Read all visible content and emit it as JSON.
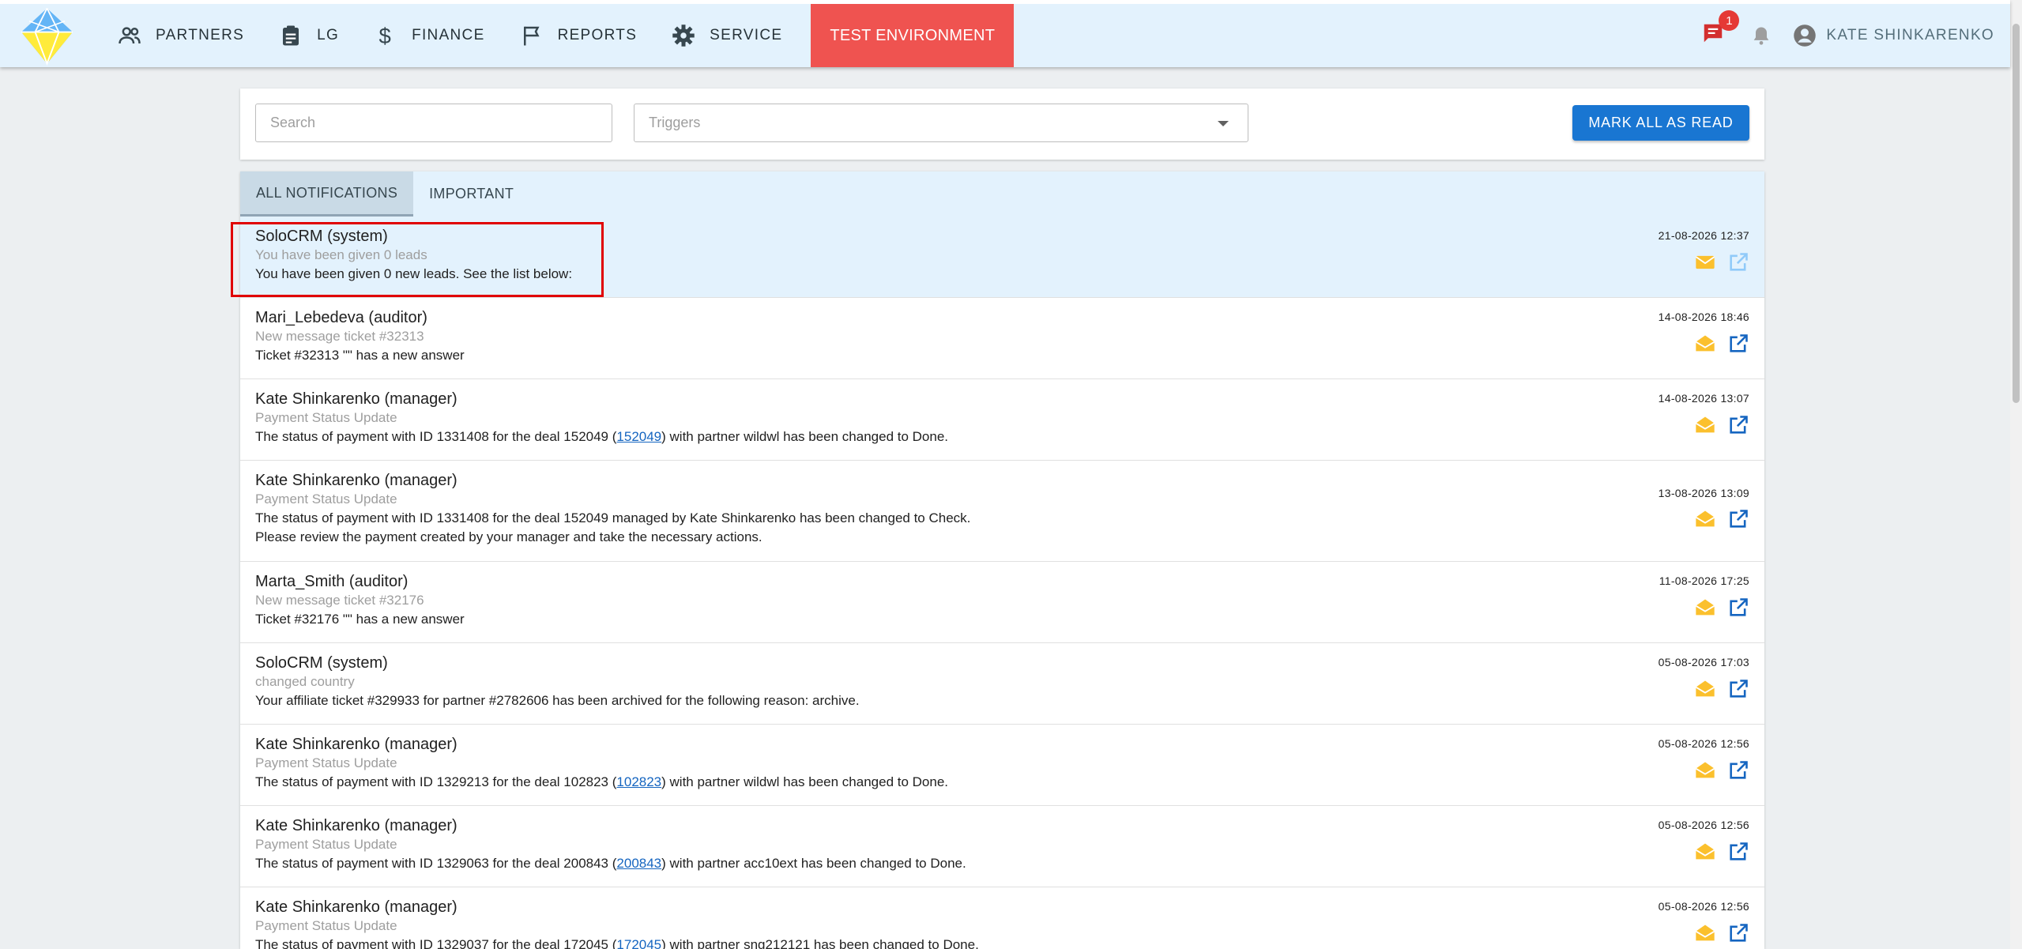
{
  "nav": {
    "items": [
      {
        "label": "PARTNERS",
        "icon": "people-icon"
      },
      {
        "label": "LG",
        "icon": "clipboard-icon"
      },
      {
        "label": "FINANCE",
        "icon": "dollar-icon"
      },
      {
        "label": "REPORTS",
        "icon": "flag-icon"
      },
      {
        "label": "SERVICE",
        "icon": "gear-icon"
      }
    ],
    "test_env": "TEST ENVIRONMENT",
    "chat_badge": "1",
    "user_name": "KATE SHINKARENKO"
  },
  "filters": {
    "search_placeholder": "Search",
    "triggers_placeholder": "Triggers",
    "mark_all": "MARK ALL AS READ"
  },
  "tabs": [
    "ALL NOTIFICATIONS",
    "IMPORTANT"
  ],
  "colors": {
    "accent": "#1976d2",
    "test_env": "#ef5350",
    "mail_icon": "#fbc02d",
    "topbar": "#e3f2fd"
  },
  "notifications": [
    {
      "author": "SoloCRM (system)",
      "subject": "You have been given 0 leads",
      "body_pre": "You have been given 0 new leads. See the list below:",
      "body_link": "",
      "body_post": "",
      "body_line2": "",
      "date": "21-08-2026 12:37",
      "unread": true
    },
    {
      "author": "Mari_Lebedeva (auditor)",
      "subject": "New message ticket #32313",
      "body_pre": "Ticket #32313 \"\" has a new answer",
      "body_link": "",
      "body_post": "",
      "body_line2": "",
      "date": "14-08-2026 18:46",
      "unread": false
    },
    {
      "author": "Kate Shinkarenko (manager)",
      "subject": "Payment Status Update",
      "body_pre": "The status of payment with ID 1331408 for the deal 152049 (",
      "body_link": "152049",
      "body_post": ") with partner wildwl has been changed to Done.",
      "body_line2": "",
      "date": "14-08-2026 13:07",
      "unread": false
    },
    {
      "author": "Kate Shinkarenko (manager)",
      "subject": "Payment Status Update",
      "body_pre": "The status of payment with ID 1331408 for the deal 152049 managed by Kate Shinkarenko has been changed to Check.",
      "body_link": "",
      "body_post": "",
      "body_line2": "Please review the payment created by your manager and take the necessary actions.",
      "date": "13-08-2026 13:09",
      "unread": false
    },
    {
      "author": "Marta_Smith (auditor)",
      "subject": "New message ticket #32176",
      "body_pre": "Ticket #32176 \"\" has a new answer",
      "body_link": "",
      "body_post": "",
      "body_line2": "",
      "date": "11-08-2026 17:25",
      "unread": false
    },
    {
      "author": "SoloCRM (system)",
      "subject": "changed country",
      "body_pre": "Your affiliate ticket #329933 for partner #2782606 has been archived for the following reason: archive.",
      "body_link": "",
      "body_post": "",
      "body_line2": "",
      "date": "05-08-2026 17:03",
      "unread": false
    },
    {
      "author": "Kate Shinkarenko (manager)",
      "subject": "Payment Status Update",
      "body_pre": "The status of payment with ID 1329213 for the deal 102823 (",
      "body_link": "102823",
      "body_post": ") with partner wildwl has been changed to Done.",
      "body_line2": "",
      "date": "05-08-2026 12:56",
      "unread": false
    },
    {
      "author": "Kate Shinkarenko (manager)",
      "subject": "Payment Status Update",
      "body_pre": "The status of payment with ID 1329063 for the deal 200843 (",
      "body_link": "200843",
      "body_post": ") with partner acc10ext has been changed to Done.",
      "body_line2": "",
      "date": "05-08-2026 12:56",
      "unread": false
    },
    {
      "author": "Kate Shinkarenko (manager)",
      "subject": "Payment Status Update",
      "body_pre": "The status of payment with ID 1329037 for the deal 172045 (",
      "body_link": "172045",
      "body_post": ") with partner sng212121 has been changed to Done.",
      "body_line2": "",
      "date": "05-08-2026 12:56",
      "unread": false
    }
  ]
}
